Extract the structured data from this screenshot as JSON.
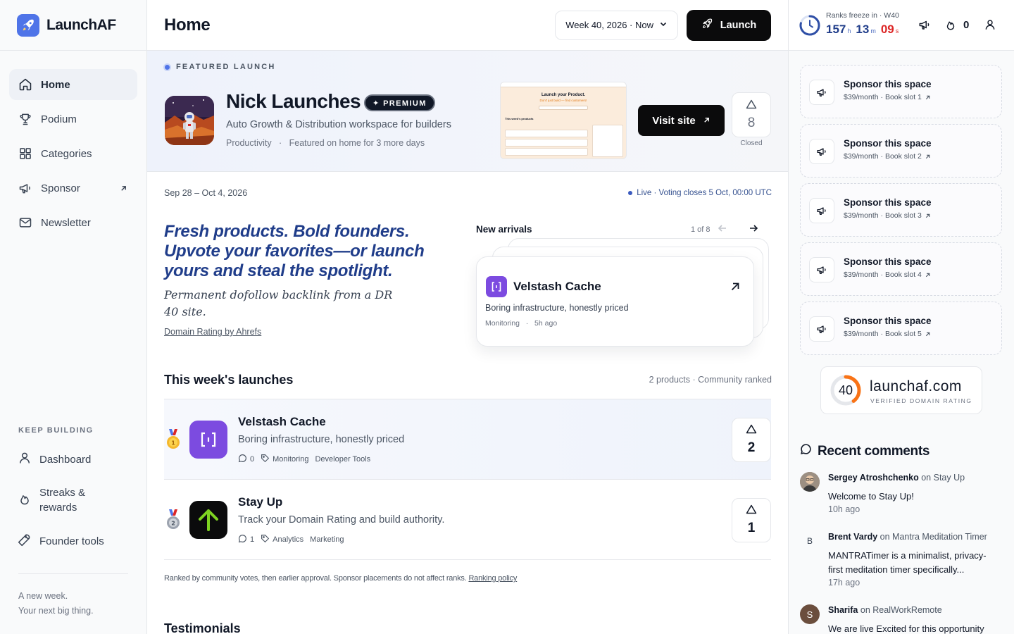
{
  "brand": {
    "name": "LaunchAF"
  },
  "sidebar": {
    "items": [
      {
        "label": "Home",
        "icon": "home-icon",
        "active": true
      },
      {
        "label": "Podium",
        "icon": "trophy-icon"
      },
      {
        "label": "Categories",
        "icon": "grid-icon"
      },
      {
        "label": "Sponsor",
        "icon": "megaphone-icon",
        "external": true
      },
      {
        "label": "Newsletter",
        "icon": "mail-icon"
      }
    ],
    "keep_building": {
      "title": "KEEP BUILDING",
      "items": [
        {
          "label": "Dashboard",
          "icon": "user-icon"
        },
        {
          "label": "Streaks & rewards",
          "icon": "flame-icon"
        },
        {
          "label": "Founder tools",
          "icon": "wrench-icon"
        }
      ]
    },
    "footer": {
      "line1": "A new week.",
      "line2": "Your next big thing."
    }
  },
  "header": {
    "title": "Home",
    "week_select": "Week 40, 2026 · Now",
    "launch_label": "Launch"
  },
  "featured": {
    "tag": "FEATURED LAUNCH",
    "name": "Nick Launches",
    "badge": "✦ PREMIUM",
    "description": "Auto Growth & Distribution workspace for builders",
    "category": "Productivity",
    "note": "Featured on home for 3 more days",
    "visit_label": "Visit site",
    "votes": "8",
    "vote_status": "Closed",
    "screenshot": {
      "title": "Launch your Product.",
      "subtitle": "Don't just build — find customers!",
      "list_heading": "This week's products"
    }
  },
  "week": {
    "range": "Sep 28 – Oct 4, 2026",
    "live": "Live · Voting closes 5 Oct, 00:00 UTC"
  },
  "hero": {
    "headline": "Fresh products. Bold founders. Upvote your favorites—or launch yours and steal the spotlight.",
    "subline": "Permanent dofollow backlink from a DR 40 site.",
    "link": "Domain Rating by Ahrefs"
  },
  "arrivals": {
    "title": "New arrivals",
    "count": "1 of 8",
    "card": {
      "name": "Velstash Cache",
      "description": "Boring infrastructure, honestly priced",
      "category": "Monitoring",
      "time": "5h ago"
    }
  },
  "launches": {
    "title": "This week's launches",
    "meta": "2 products · Community ranked",
    "rows": [
      {
        "name": "Velstash Cache",
        "description": "Boring infrastructure, honestly priced",
        "comments": "0",
        "tags": [
          "Monitoring",
          "Developer Tools"
        ],
        "votes": "2",
        "medal": "gold",
        "logo_color": "#7c4be0"
      },
      {
        "name": "Stay Up",
        "description": "Track your Domain Rating and build authority.",
        "comments": "1",
        "tags": [
          "Analytics",
          "Marketing"
        ],
        "votes": "1",
        "medal": "silver",
        "logo_color": "#0b0b0c"
      }
    ],
    "ranking_note": "Ranked by community votes, then earlier approval. Sponsor placements do not affect ranks.",
    "ranking_link": "Ranking policy"
  },
  "testimonials": {
    "title": "Testimonials"
  },
  "right": {
    "freeze_label": "Ranks freeze in · W40",
    "timer": {
      "h": "157",
      "h_unit": "h",
      "m": "13",
      "m_unit": "m",
      "s": "09",
      "s_unit": "s"
    },
    "streak": "0",
    "sponsors": [
      {
        "title": "Sponsor this space",
        "sub": "$39/month · Book slot 1"
      },
      {
        "title": "Sponsor this space",
        "sub": "$39/month · Book slot 2"
      },
      {
        "title": "Sponsor this space",
        "sub": "$39/month · Book slot 3"
      },
      {
        "title": "Sponsor this space",
        "sub": "$39/month · Book slot 4"
      },
      {
        "title": "Sponsor this space",
        "sub": "$39/month · Book slot 5"
      }
    ],
    "dr": {
      "value": "40",
      "fraction": 0.4,
      "domain": "launchaf.com",
      "label": "VERIFIED DOMAIN RATING"
    },
    "comments_title": "Recent comments",
    "comments": [
      {
        "author": "Sergey Atroshchenko",
        "on": "on",
        "product": "Stay Up",
        "text": "Welcome to Stay Up!",
        "time": "10h ago",
        "initial": ""
      },
      {
        "author": "Brent Vardy",
        "on": "on",
        "product": "Mantra Meditation Timer",
        "text": "MANTRATimer is a minimalist, privacy-first meditation timer specifically...",
        "time": "17h ago",
        "initial": "B"
      },
      {
        "author": "Sharifa",
        "on": "on",
        "product": "RealWorkRemote",
        "text": "We are live Excited for this opportunity",
        "time": "",
        "initial": "S"
      }
    ]
  },
  "colors": {
    "accent": "#4f74e8",
    "hero": "#203d8a",
    "timer_red": "#dc2626"
  }
}
